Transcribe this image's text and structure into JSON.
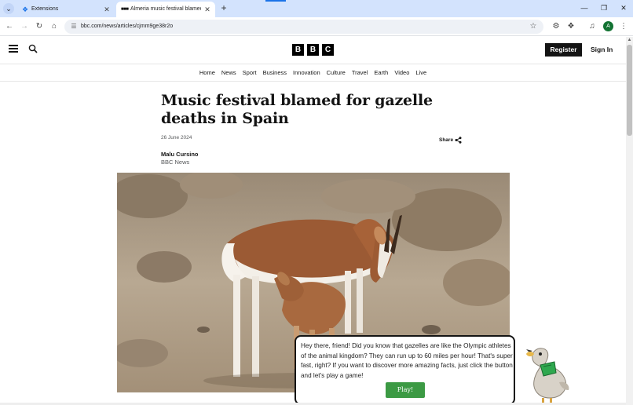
{
  "browser": {
    "tabs": [
      {
        "label": "Extensions",
        "active": false
      },
      {
        "label": "Almeria music festival blamed fo",
        "active": true
      }
    ],
    "url": "bbc.com/news/articles/cjmm9ge38r2o",
    "profile_initial": "A"
  },
  "site": {
    "logo_letters": [
      "B",
      "B",
      "C"
    ],
    "register_label": "Register",
    "signin_label": "Sign In",
    "nav_items": [
      "Home",
      "News",
      "Sport",
      "Business",
      "Innovation",
      "Culture",
      "Travel",
      "Earth",
      "Video",
      "Live"
    ]
  },
  "article": {
    "headline": "Music festival blamed for gazelle deaths in Spain",
    "date": "26 June 2024",
    "share_label": "Share",
    "author": "Malu Cursino",
    "source": "BBC News"
  },
  "popup": {
    "message": "Hey there, friend! Did you know that gazelles are like the Olympic athletes of the animal kingdom? They can run up to 60 miles per hour! That's super fast, right? If you want to discover more amazing facts, just click the button and let's play a game!",
    "button_label": "Play!"
  },
  "colors": {
    "tabstrip": "#d3e3fd",
    "bbc_black": "#141414",
    "play_green": "#3c9a44"
  }
}
